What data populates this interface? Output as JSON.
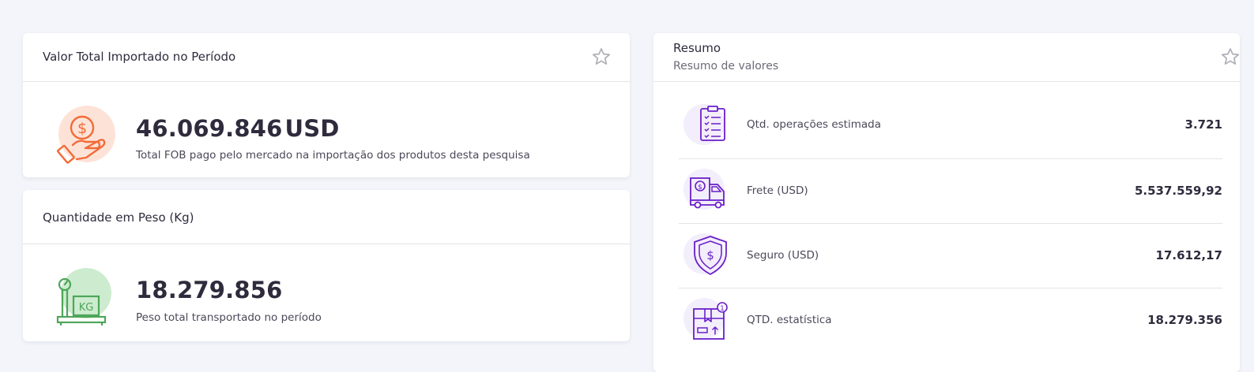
{
  "colors": {
    "background": "#f4f5fa",
    "card": "#ffffff",
    "accent_orange": "#f26b38",
    "accent_green": "#4ea65a",
    "accent_purple": "#6a1fc9",
    "star": "#b0b0b8"
  },
  "valor_card": {
    "title": "Valor Total Importado no Período",
    "value": "46.069.846",
    "unit": "USD",
    "description": "Total FOB pago pelo mercado na importação dos produtos desta pesquisa",
    "icon": "hand-coin-icon",
    "favorite_icon": "star-icon"
  },
  "peso_card": {
    "title": "Quantidade em Peso (Kg)",
    "value": "18.279.856",
    "description": "Peso total transportado no período",
    "icon": "weighing-scale-icon"
  },
  "resumo_card": {
    "title": "Resumo",
    "subtitle": "Resumo de valores",
    "favorite_icon": "star-icon",
    "items": [
      {
        "label": "Qtd. operações estimada",
        "value": "3.721",
        "icon": "clipboard-checklist-icon"
      },
      {
        "label": "Frete (USD)",
        "value": "5.537.559,92",
        "icon": "delivery-truck-icon"
      },
      {
        "label": "Seguro (USD)",
        "value": "17.612,17",
        "icon": "shield-dollar-icon"
      },
      {
        "label": "QTD. estatística",
        "value": "18.279.356",
        "icon": "box-count-icon"
      }
    ]
  }
}
